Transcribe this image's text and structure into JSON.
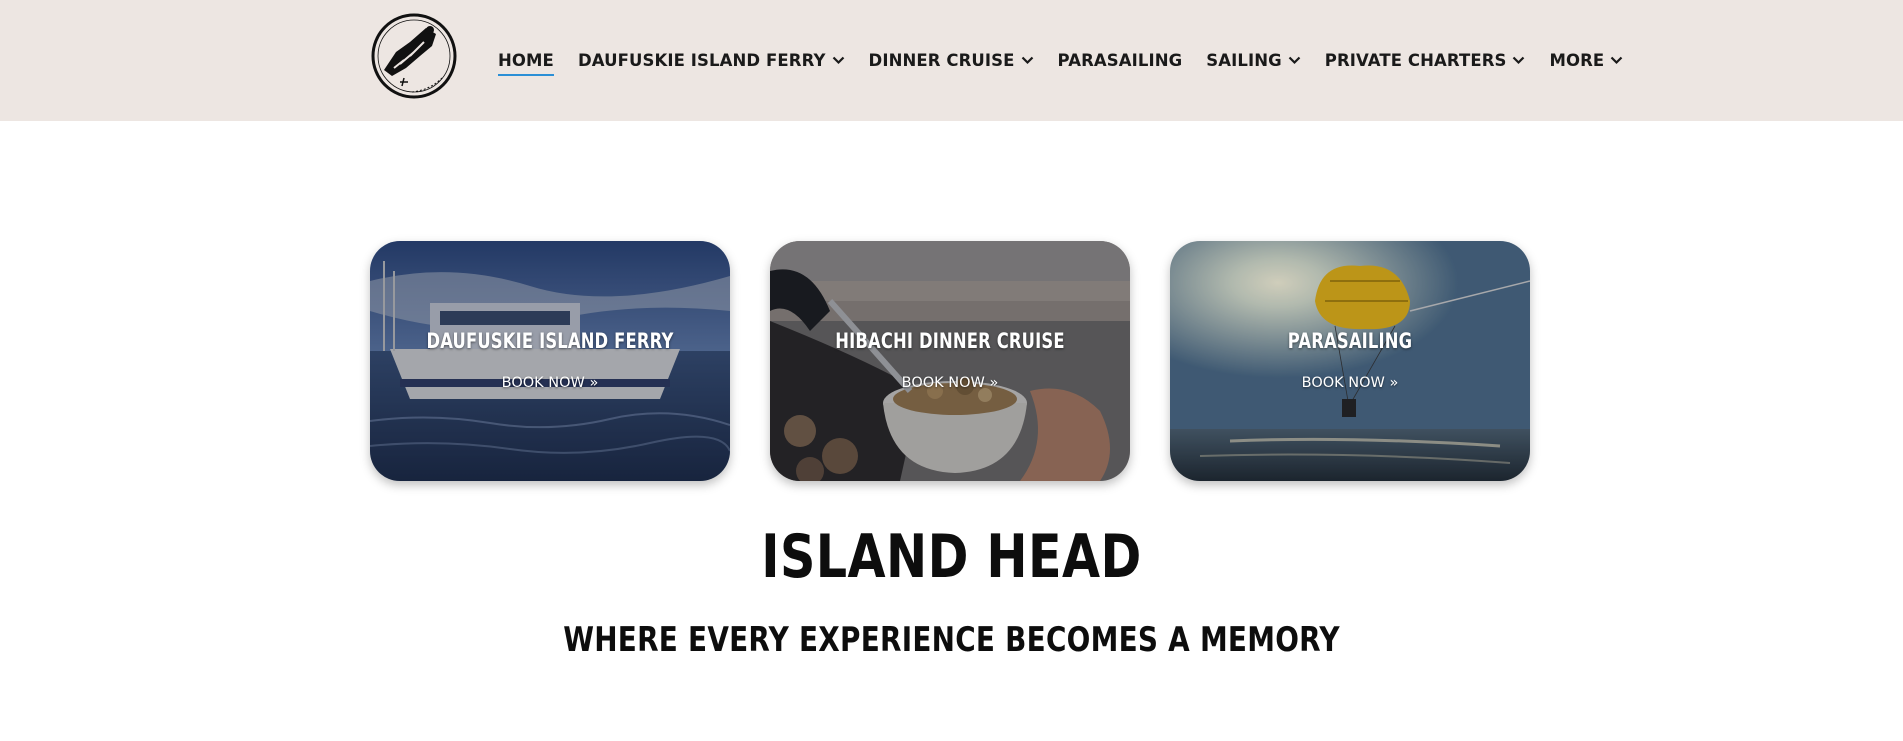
{
  "nav": {
    "items": [
      {
        "label": "HOME",
        "dropdown": false,
        "active": true
      },
      {
        "label": "DAUFUSKIE ISLAND FERRY",
        "dropdown": true,
        "active": false
      },
      {
        "label": "DINNER CRUISE",
        "dropdown": true,
        "active": false
      },
      {
        "label": "PARASAILING",
        "dropdown": false,
        "active": false
      },
      {
        "label": "SAILING",
        "dropdown": true,
        "active": false
      },
      {
        "label": "PRIVATE CHARTERS",
        "dropdown": true,
        "active": false
      },
      {
        "label": "MORE",
        "dropdown": true,
        "active": false
      }
    ],
    "active_color": "#2b8fd6"
  },
  "header": {
    "background": "#ede6e2",
    "logo_icon": "island-head-logo-icon"
  },
  "cards": [
    {
      "title": "DAUFUSKIE ISLAND FERRY",
      "cta": "BOOK NOW »",
      "image": "ferry-boat-image"
    },
    {
      "title": "HIBACHI DINNER CRUISE",
      "cta": "BOOK NOW »",
      "image": "hibachi-bowl-image"
    },
    {
      "title": "PARASAILING",
      "cta": "BOOK NOW »",
      "image": "parasail-image"
    }
  ],
  "main": {
    "headline": "ISLAND HEAD",
    "subheadline": "WHERE EVERY EXPERIENCE BECOMES A MEMORY"
  }
}
